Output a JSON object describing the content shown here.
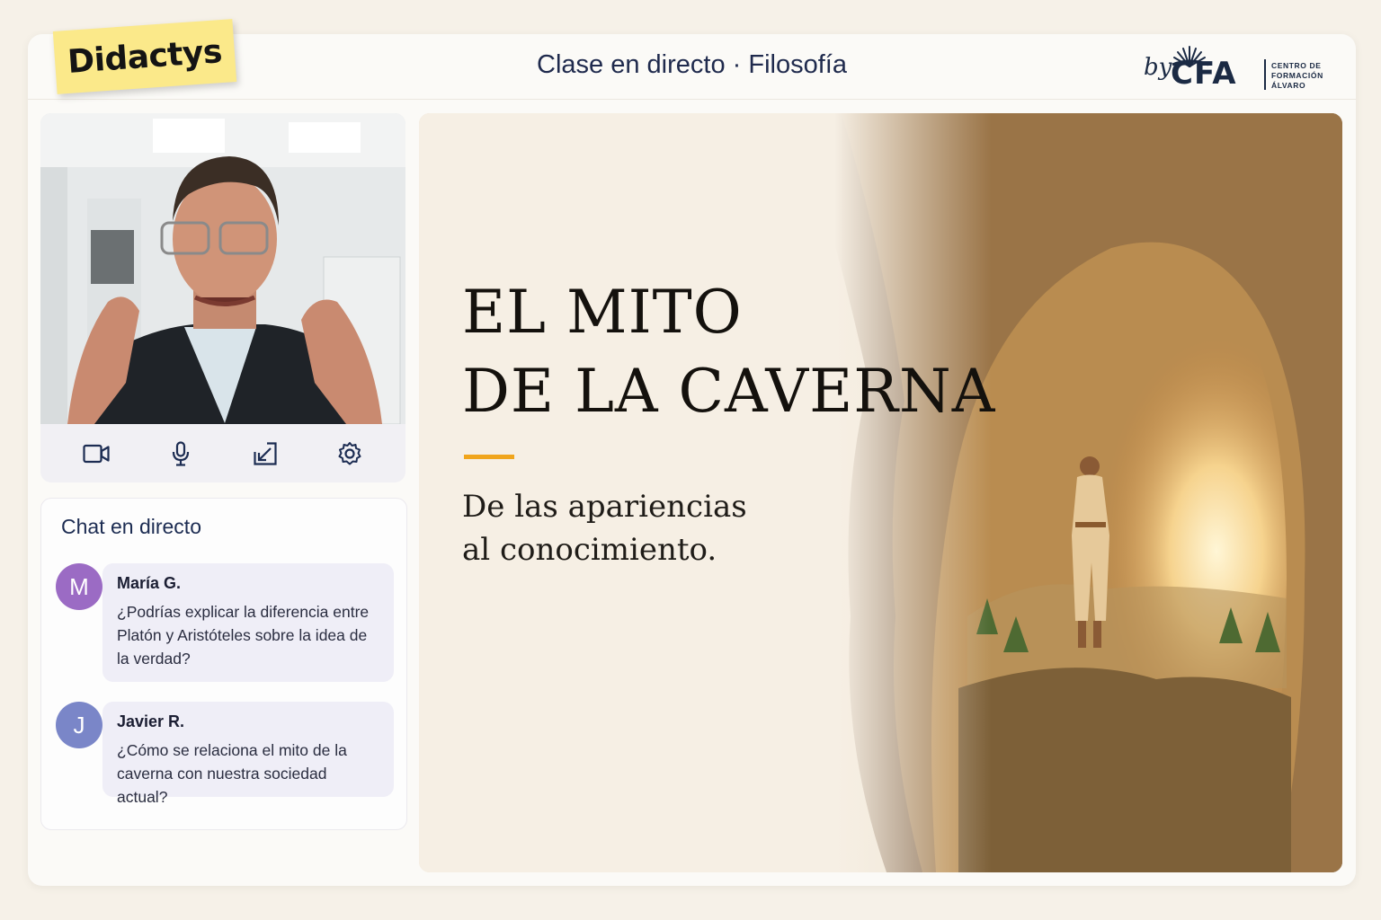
{
  "header": {
    "app_name": "Didactys",
    "title": "Clase en directo · Filosofía",
    "brand": {
      "by": "by",
      "name": "CFA",
      "subtitle": [
        "CENTRO DE",
        "FORMACIÓN",
        "ÁLVARO"
      ]
    }
  },
  "video": {
    "controls": [
      {
        "name": "camera-icon"
      },
      {
        "name": "microphone-icon"
      },
      {
        "name": "screen-share-icon"
      },
      {
        "name": "settings-gear-icon"
      }
    ]
  },
  "chat": {
    "title": "Chat en directo",
    "messages": [
      {
        "initial": "M",
        "author": "María G.",
        "text": "¿Podrías explicar la diferencia entre Platón y Aristóteles sobre la idea de la verdad?",
        "avatar_color": "#9b6bc4"
      },
      {
        "initial": "J",
        "author": "Javier R.",
        "text": "¿Cómo se relaciona el mito de la caverna con nuestra sociedad actual?",
        "avatar_color": "#7a86c8"
      }
    ]
  },
  "slide": {
    "title_line1": "EL MITO",
    "title_line2": "DE LA CAVERNA",
    "subtitle_line1": "De las apariencias",
    "subtitle_line2": "al conocimiento.",
    "accent_color": "#f0a51c"
  }
}
